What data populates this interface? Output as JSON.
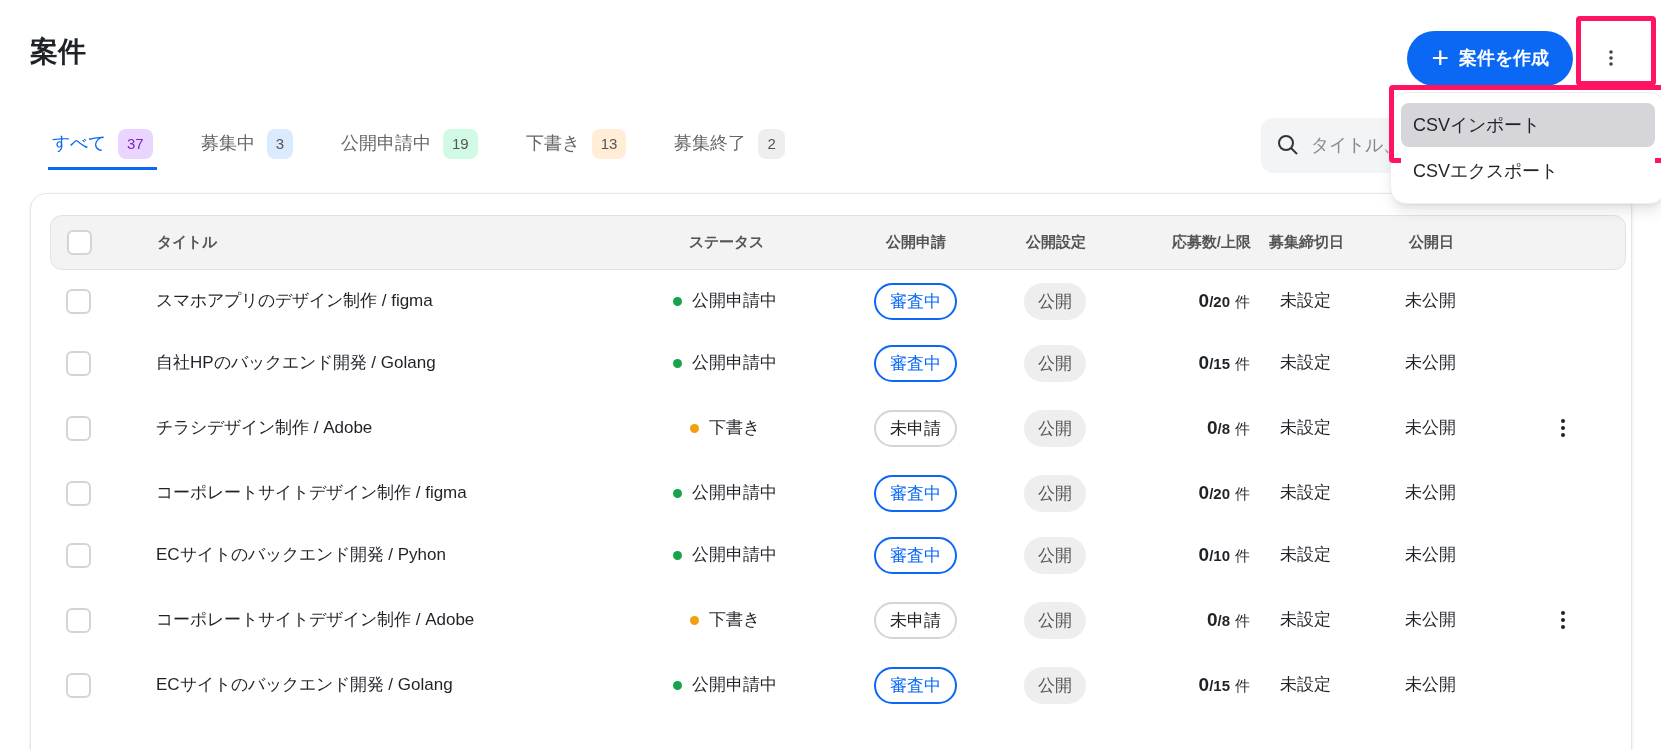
{
  "page_title": "案件",
  "create_button": {
    "icon": "+",
    "label": "案件を作成"
  },
  "more_button": {
    "highlighted": true
  },
  "tabs": [
    {
      "label": "すべて",
      "count": "37",
      "color": "#e9d5ff",
      "selected": true
    },
    {
      "label": "募集中",
      "count": "3",
      "color": "#dbeafe",
      "selected": false
    },
    {
      "label": "公開申請中",
      "count": "19",
      "color": "#d1fae5",
      "selected": false
    },
    {
      "label": "下書き",
      "count": "13",
      "color": "#ffedd5",
      "selected": false
    },
    {
      "label": "募集終了",
      "count": "2",
      "color": "#eeeeee",
      "selected": false
    }
  ],
  "search": {
    "placeholder": "タイトル、"
  },
  "menu": {
    "items": [
      {
        "label": "CSVインポート",
        "selected": true,
        "highlighted": true
      },
      {
        "label": "CSVエクスポート",
        "selected": false,
        "highlighted": false
      }
    ]
  },
  "table": {
    "select_all": {
      "checked": false
    },
    "columns": [
      "タイトル",
      "ステータス",
      "公開申請",
      "公開設定",
      "応募数/上限",
      "募集締切日",
      "公開日"
    ],
    "rows": [
      {
        "checked": false,
        "title": "スマホアプリのデザイン制作 / figma",
        "status": "公開申請中",
        "color": "#16a34a",
        "application": {
          "kind": "reviewing",
          "label": "審査中"
        },
        "visibility": "公開",
        "count": "0",
        "limit": "/20",
        "unit": "件",
        "deadline": "未設定",
        "published": "未公開",
        "has_menu": false
      },
      {
        "checked": false,
        "title": "自社HPのバックエンド開発 / Golang",
        "status": "公開申請中",
        "color": "#16a34a",
        "application": {
          "kind": "reviewing",
          "label": "審査中"
        },
        "visibility": "公開",
        "count": "0",
        "limit": "/15",
        "unit": "件",
        "deadline": "未設定",
        "published": "未公開",
        "has_menu": false
      },
      {
        "checked": false,
        "title": "チラシデザイン制作 / Adobe",
        "status": "下書き",
        "color": "#f59e0b",
        "application": {
          "kind": "not_applied",
          "label": "未申請"
        },
        "visibility": "公開",
        "count": "0",
        "limit": "/8",
        "unit": "件",
        "deadline": "未設定",
        "published": "未公開",
        "has_menu": true
      },
      {
        "checked": false,
        "title": "コーポレートサイトデザイン制作 / figma",
        "status": "公開申請中",
        "color": "#16a34a",
        "application": {
          "kind": "reviewing",
          "label": "審査中"
        },
        "visibility": "公開",
        "count": "0",
        "limit": "/20",
        "unit": "件",
        "deadline": "未設定",
        "published": "未公開",
        "has_menu": false
      },
      {
        "checked": false,
        "title": "ECサイトのバックエンド開発 / Pyhon",
        "status": "公開申請中",
        "color": "#16a34a",
        "application": {
          "kind": "reviewing",
          "label": "審査中"
        },
        "visibility": "公開",
        "count": "0",
        "limit": "/10",
        "unit": "件",
        "deadline": "未設定",
        "published": "未公開",
        "has_menu": false
      },
      {
        "checked": false,
        "title": "コーポレートサイトデザイン制作 / Adobe",
        "status": "下書き",
        "color": "#f59e0b",
        "application": {
          "kind": "not_applied",
          "label": "未申請"
        },
        "visibility": "公開",
        "count": "0",
        "limit": "/8",
        "unit": "件",
        "deadline": "未設定",
        "published": "未公開",
        "has_menu": true
      },
      {
        "checked": false,
        "title": "ECサイトのバックエンド開発 / Golang",
        "status": "公開申請中",
        "color": "#16a34a",
        "application": {
          "kind": "reviewing",
          "label": "審査中"
        },
        "visibility": "公開",
        "count": "0",
        "limit": "/15",
        "unit": "件",
        "deadline": "未設定",
        "published": "未公開",
        "has_menu": false
      }
    ]
  }
}
